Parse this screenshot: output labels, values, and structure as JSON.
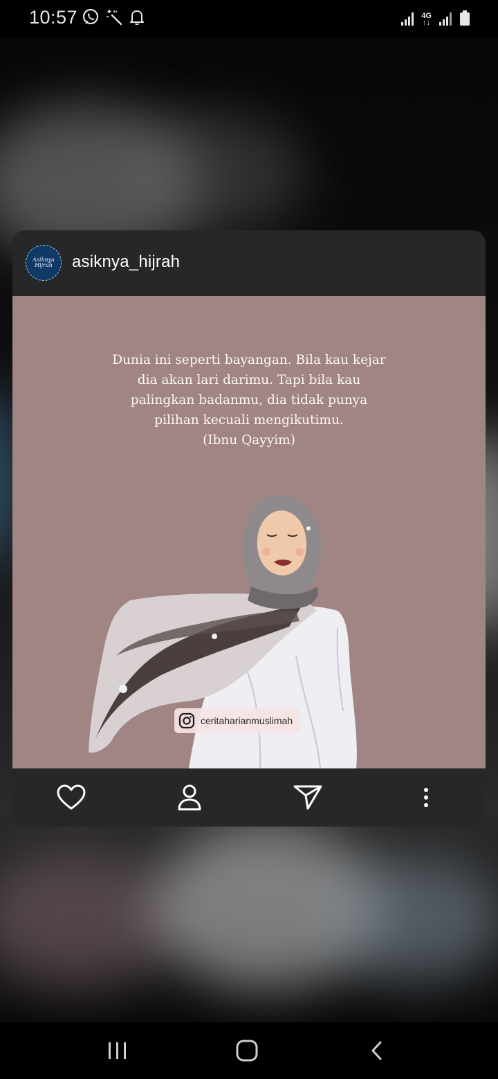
{
  "status_bar": {
    "time": "10:57",
    "notification_icons": [
      "whatsapp-icon",
      "magic-wand-icon",
      "notification-bell-icon"
    ],
    "network_label": "4G",
    "network_sub": "↑↓",
    "system_icons": [
      "signal-icon",
      "signal-icon",
      "battery-icon"
    ]
  },
  "post": {
    "avatar_text": "Asiknya Hijrah",
    "username": "asiknya_hijrah",
    "quote_lines": [
      "Dunia ini seperti bayangan. Bila kau kejar",
      "dia akan lari darimu. Tapi bila kau",
      "palingkan badanmu, dia tidak punya",
      "pilihan kecuali mengikutimu.",
      "(Ibnu Qayyim)"
    ],
    "watermark_handle": "ceritaharianmuslimah",
    "image_background": "#a08584"
  },
  "actions": [
    "heart-icon",
    "profile-icon",
    "send-icon",
    "more-icon"
  ],
  "nav_bar": [
    "recent-apps-icon",
    "home-icon",
    "back-icon"
  ],
  "colors": {
    "card": "#262728",
    "icon": "#ffffff",
    "status_bar": "#000000"
  }
}
